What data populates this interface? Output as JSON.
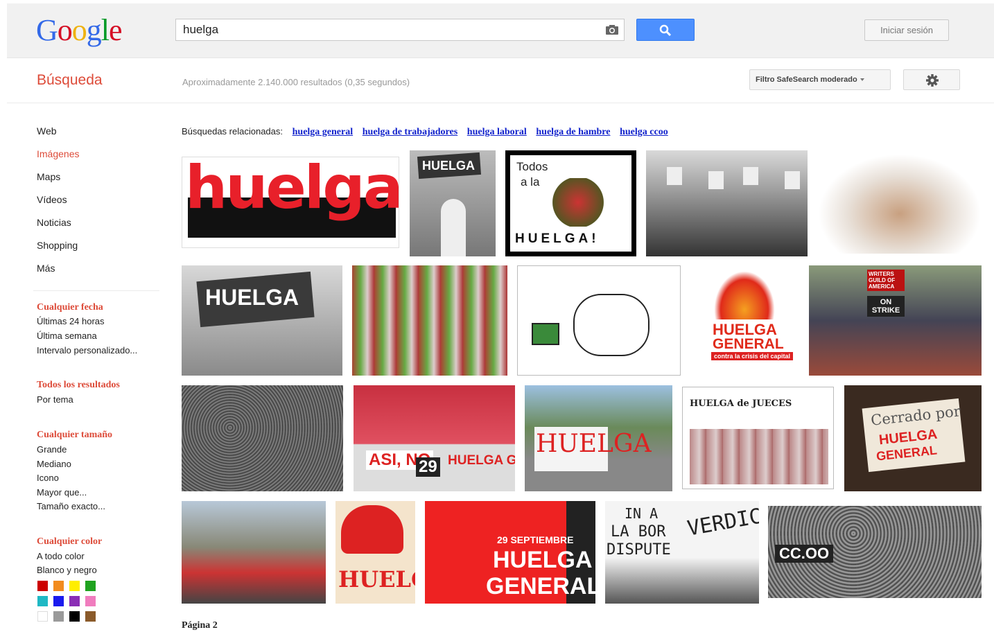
{
  "logo": {
    "letters": [
      "G",
      "o",
      "o",
      "g",
      "l",
      "e"
    ]
  },
  "search": {
    "query": "huelga",
    "button_icon": "search-icon",
    "camera_icon": "camera-icon"
  },
  "header": {
    "signin_label": "Iniciar sesión"
  },
  "section_title": "Búsqueda",
  "result_stats": "Aproximadamente 2.140.000 resultados (0,35 segundos)",
  "safesearch_label": "Filtro SafeSearch moderado",
  "settings_icon": "gear-icon",
  "nav": {
    "items": [
      {
        "label": "Web",
        "active": false
      },
      {
        "label": "Imágenes",
        "active": true
      },
      {
        "label": "Maps",
        "active": false
      },
      {
        "label": "Vídeos",
        "active": false
      },
      {
        "label": "Noticias",
        "active": false
      },
      {
        "label": "Shopping",
        "active": false
      },
      {
        "label": "Más",
        "active": false
      }
    ]
  },
  "tools": {
    "date": {
      "heading": "Cualquier fecha",
      "options": [
        "Últimas 24 horas",
        "Última semana",
        "Intervalo personalizado..."
      ]
    },
    "results": {
      "heading": "Todos los resultados",
      "options": [
        "Por tema"
      ]
    },
    "size": {
      "heading": "Cualquier tamaño",
      "options": [
        "Grande",
        "Mediano",
        "Icono",
        "Mayor que...",
        "Tamaño exacto..."
      ]
    },
    "color": {
      "heading": "Cualquier color",
      "options": [
        "A todo color",
        "Blanco y negro"
      ],
      "swatches": [
        "#cc0000",
        "#f28c1e",
        "#ffee00",
        "#1fa21f",
        "#1fb8c4",
        "#1a1aee",
        "#8a2db5",
        "#f07cbe",
        "#ffffff",
        "#9a9a9a",
        "#000000",
        "#8a5a2a"
      ]
    }
  },
  "related": {
    "label": "Búsquedas relacionadas:",
    "links": [
      "huelga general",
      "huelga de trabajadores",
      "huelga laboral",
      "huelga de hambre",
      "huelga ccoo"
    ]
  },
  "images": {
    "r1_1": "huelga",
    "r1_2": "HUELGA",
    "r1_3a": "Todos",
    "r1_3b": "a la",
    "r1_3c": "HUELGA!",
    "r2_1": "HUELGA",
    "r2_4a": "HUELGA",
    "r2_4b": "GENERAL",
    "r2_4c": "contra la crisis del capital",
    "r2_5a": "WRITERS GUILD OF AMERICA",
    "r2_5b": "ON STRIKE",
    "r3_2a": "ASI, NO",
    "r3_2b": "29",
    "r3_2c": "HUELGA G",
    "r3_3": "HUELGA",
    "r3_4": "HUELGA de JUECES",
    "r3_5a": "Cerrado por",
    "r3_5b": "HUELGA",
    "r3_5c": "GENERAL",
    "r4_2": "HUELGA",
    "r4_3a": "29 SEPTIEMBRE",
    "r4_3b": "HUELGA",
    "r4_3c": "GENERAL",
    "r4_4a": "IN A",
    "r4_4b": "LA BOR",
    "r4_4c": "DISPUTE",
    "r4_4d": "VERDICT",
    "r4_5": "CC.OO"
  },
  "pager": {
    "label": "Página 2"
  }
}
